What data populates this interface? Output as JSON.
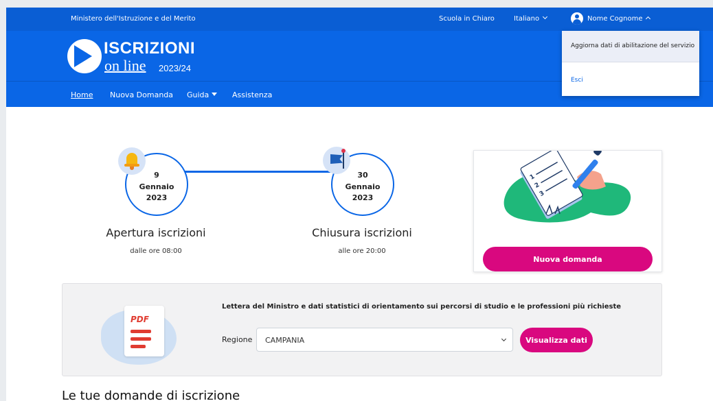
{
  "topbar": {
    "ministry": "Ministero dell'Istruzione e del Merito",
    "scuola_link": "Scuola in Chiaro",
    "language": "Italiano",
    "user_name": "Nome Cognome"
  },
  "header": {
    "logo_title": "ISCRIZIONI",
    "logo_subtitle": "on line",
    "logo_year": "2023/24"
  },
  "nav": {
    "items": [
      "Home",
      "Nuova Domanda",
      "Guida",
      "Assistenza"
    ]
  },
  "user_menu": {
    "items": [
      "Aggiorna dati di abilitazione del servizio",
      "Esci"
    ]
  },
  "timeline": {
    "open": {
      "day": "9",
      "month": "Gennaio",
      "year": "2023",
      "title": "Apertura iscrizioni",
      "sub": "dalle ore 08:00",
      "icon": "bell-icon"
    },
    "close": {
      "day": "30",
      "month": "Gennaio",
      "year": "2023",
      "title": "Chiusura iscrizioni",
      "sub": "alle ore 20:00",
      "icon": "flag-icon"
    }
  },
  "card": {
    "button": "Nuova domanda"
  },
  "stats": {
    "text": "Lettera del Ministro e dati statistici di orientamento sui percorsi di studio e le professioni più richieste",
    "region_label": "Regione",
    "region_value": "CAMPANIA",
    "button": "Visualizza dati",
    "pdf_label": "PDF"
  },
  "section": {
    "title": "Le tue domande di iscrizione"
  },
  "colors": {
    "primary": "#0a66e6",
    "accent": "#d9087f"
  }
}
